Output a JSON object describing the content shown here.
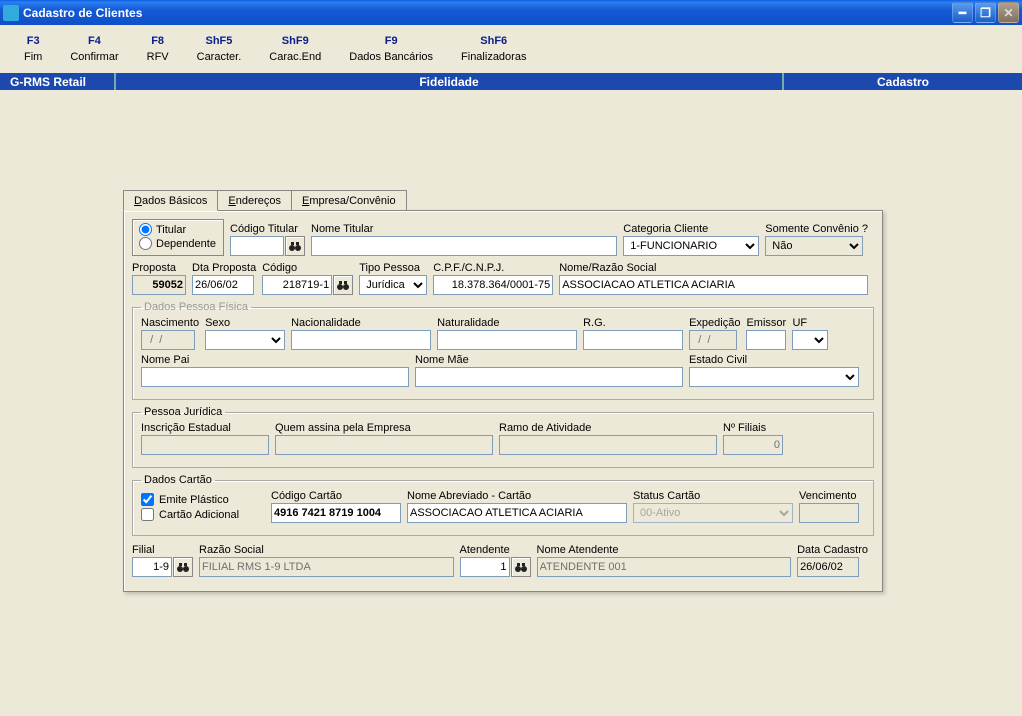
{
  "window": {
    "title": "Cadastro de Clientes"
  },
  "menu": [
    {
      "key": "F3",
      "label": "Fim"
    },
    {
      "key": "F4",
      "label": "Confirmar"
    },
    {
      "key": "F8",
      "label": "RFV"
    },
    {
      "key": "ShF5",
      "label": "Caracter."
    },
    {
      "key": "ShF9",
      "label": "Carac.End"
    },
    {
      "key": "F9",
      "label": "Dados Bancários"
    },
    {
      "key": "ShF6",
      "label": "Finalizadoras"
    }
  ],
  "banner": {
    "left": "G-RMS Retail",
    "mid": "Fidelidade",
    "right": "Cadastro"
  },
  "tabs": {
    "t0": "Dados Básicos",
    "t1": "Endereços",
    "t2": "Empresa/Convênio"
  },
  "top": {
    "titular": "Titular",
    "dependente": "Dependente",
    "cod_titular_lbl": "Código Titular",
    "cod_titular": "",
    "nome_titular_lbl": "Nome Titular",
    "nome_titular": "",
    "cat_cliente_lbl": "Categoria Cliente",
    "cat_cliente": "1-FUNCIONARIO",
    "somente_lbl": "Somente Convênio ?",
    "somente": "Não"
  },
  "r2": {
    "proposta_lbl": "Proposta",
    "proposta": "59052",
    "dtaproposta_lbl": "Dta Proposta",
    "dtaproposta": "26/06/02",
    "codigo_lbl": "Código",
    "codigo": "218719-1",
    "tipopessoa_lbl": "Tipo Pessoa",
    "tipopessoa": "Jurídica",
    "cpf_lbl": "C.P.F./C.N.P.J.",
    "cpf": "18.378.364/0001-75",
    "razao_lbl": "Nome/Razão Social",
    "razao": "ASSOCIACAO ATLETICA ACIARIA"
  },
  "pf": {
    "legend": "Dados Pessoa Física",
    "nasc_lbl": "Nascimento",
    "nasc": "  /  /",
    "sexo_lbl": "Sexo",
    "nac_lbl": "Nacionalidade",
    "nat_lbl": "Naturalidade",
    "rg_lbl": "R.G.",
    "exp_lbl": "Expedição",
    "exp": "  /  /",
    "emissor_lbl": "Emissor",
    "uf_lbl": "UF",
    "nomepai_lbl": "Nome Pai",
    "nomemae_lbl": "Nome Mãe",
    "estcivil_lbl": "Estado Civil"
  },
  "pj": {
    "legend": "Pessoa Jurídica",
    "insc_lbl": "Inscrição Estadual",
    "insc": "",
    "assina_lbl": "Quem assina pela Empresa",
    "assina": "",
    "ramo_lbl": "Ramo de Atividade",
    "ramo": "",
    "nfiliais_lbl": "Nº Filiais",
    "nfiliais": "0"
  },
  "cartao": {
    "legend": "Dados Cartão",
    "emite": "Emite Plástico",
    "adicional": "Cartão Adicional",
    "cod_lbl": "Código Cartão",
    "cod": "4916 7421 8719 1004",
    "nome_lbl": "Nome Abreviado - Cartão",
    "nome": "ASSOCIACAO ATLETICA ACIARIA",
    "status_lbl": "Status Cartão",
    "status": "00-Ativo",
    "venc_lbl": "Vencimento",
    "venc": ""
  },
  "footer": {
    "filial_lbl": "Filial",
    "filial": "1-9",
    "razao_lbl": "Razão Social",
    "razao": "FILIAL RMS 1-9 LTDA",
    "atend_lbl": "Atendente",
    "atend": "1",
    "nomeatend_lbl": "Nome Atendente",
    "nomeatend": "ATENDENTE 001",
    "dtcad_lbl": "Data Cadastro",
    "dtcad": "26/06/02"
  }
}
